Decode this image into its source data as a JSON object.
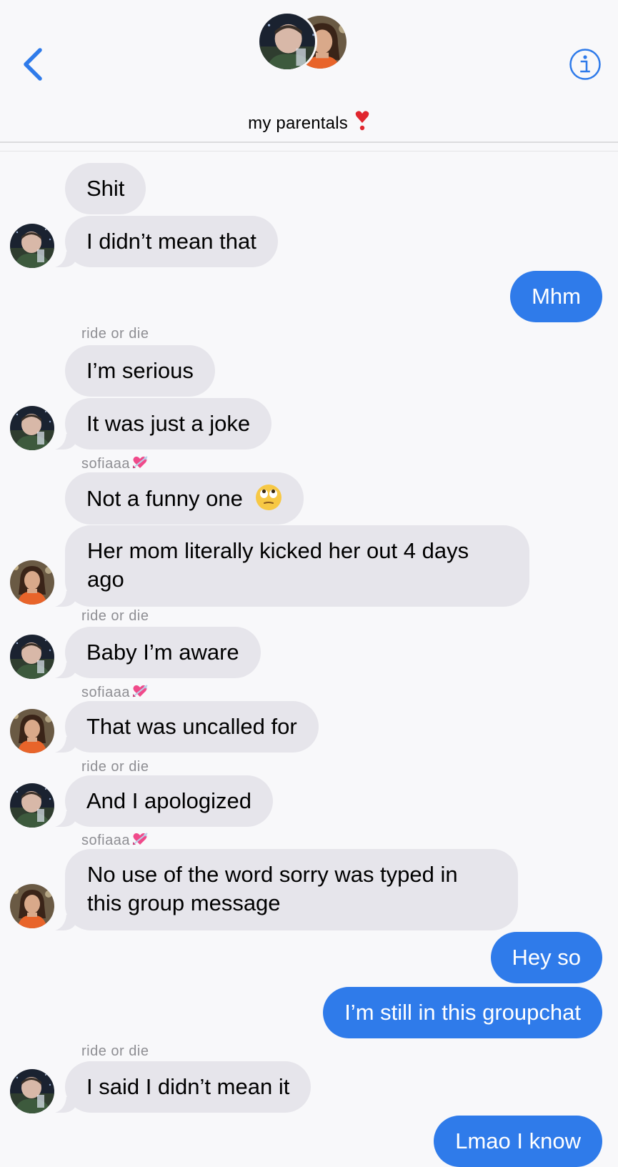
{
  "header": {
    "title": "my parentals",
    "title_emoji": "heart-exclamation-icon"
  },
  "messages": [
    {
      "from": "them",
      "text": "Shit"
    },
    {
      "from": "them",
      "text": "I didn’t mean that"
    },
    {
      "from": "me",
      "text": "Mhm"
    },
    {
      "sender": "ride or die"
    },
    {
      "from": "them",
      "text": "I’m serious"
    },
    {
      "from": "them",
      "text": "It was just a joke"
    },
    {
      "sender": "sofiaaa"
    },
    {
      "from": "them",
      "text": "Not a funny one"
    },
    {
      "from": "them",
      "text": "Her mom literally kicked her out 4 days ago"
    },
    {
      "sender": "ride or die"
    },
    {
      "from": "them",
      "text": "Baby I’m aware"
    },
    {
      "sender": "sofiaaa"
    },
    {
      "from": "them",
      "text": "That was uncalled for"
    },
    {
      "sender": "ride or die"
    },
    {
      "from": "them",
      "text": "And I apologized"
    },
    {
      "sender": "sofiaaa"
    },
    {
      "from": "them",
      "text": "No use of the word sorry was typed in this group message"
    },
    {
      "from": "me",
      "text": "Hey so"
    },
    {
      "from": "me",
      "text": "I’m still in this groupchat"
    },
    {
      "sender": "ride or die"
    },
    {
      "from": "them",
      "text": "I said I didn’t mean it"
    },
    {
      "from": "me",
      "text": "Lmao I know"
    }
  ],
  "colors": {
    "outgoing": "#2f7bea",
    "incoming": "#e6e5eb",
    "accent": "#2f7bea"
  }
}
